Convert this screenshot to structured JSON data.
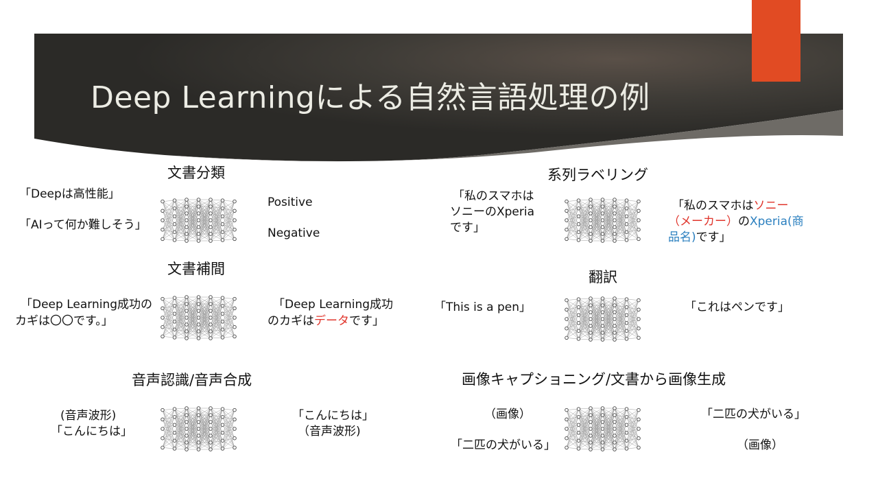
{
  "slide": {
    "title": "Deep Learningによる自然言語処理の例",
    "colors": {
      "banner": "#3d3b36",
      "accent": "#e14b23",
      "highlight_red": "#e0342b",
      "highlight_blue": "#2a7fbf"
    }
  },
  "sections": {
    "doc_classification": {
      "heading": "文書分類",
      "inputs": [
        "「Deepは高性能」",
        "「AIって何か難しそう」"
      ],
      "outputs": [
        "Positive",
        "Negative"
      ]
    },
    "doc_completion": {
      "heading": "文書補間",
      "input": [
        "「Deep Learning成功の",
        "カギは〇〇です。」"
      ],
      "output_line1": "「Deep Learning成功",
      "output_line2": {
        "before": "のカギは",
        "highlight": "データ",
        "after": "です」"
      }
    },
    "speech": {
      "heading": "音声認識/音声合成",
      "input": [
        "(音声波形)",
        "「こんにちは」"
      ],
      "output": [
        "「こんにちは」",
        "（音声波形)"
      ]
    },
    "sequence_labeling": {
      "heading": "系列ラベリング",
      "input": [
        "「私のスマホは",
        "ソニーのXperia",
        "です」"
      ],
      "output_line1": {
        "before": "「私のスマホは",
        "highlight": "ソニー"
      },
      "output_line2": {
        "highlight_red": "（メーカー）",
        "middle": "の",
        "highlight_blue": "Xperia(商"
      },
      "output_line3": {
        "highlight_blue": "品名)",
        "after": "です」"
      }
    },
    "translation": {
      "heading": "翻訳",
      "input": "「This is a pen」",
      "output": "「これはペンです」"
    },
    "captioning": {
      "heading": "画像キャプショニング/文書から画像生成",
      "inputs": [
        "（画像）",
        "「二匹の犬がいる」"
      ],
      "outputs": [
        "「二匹の犬がいる」",
        "（画像）"
      ]
    }
  },
  "icons": {
    "network": "neural-network-icon"
  }
}
